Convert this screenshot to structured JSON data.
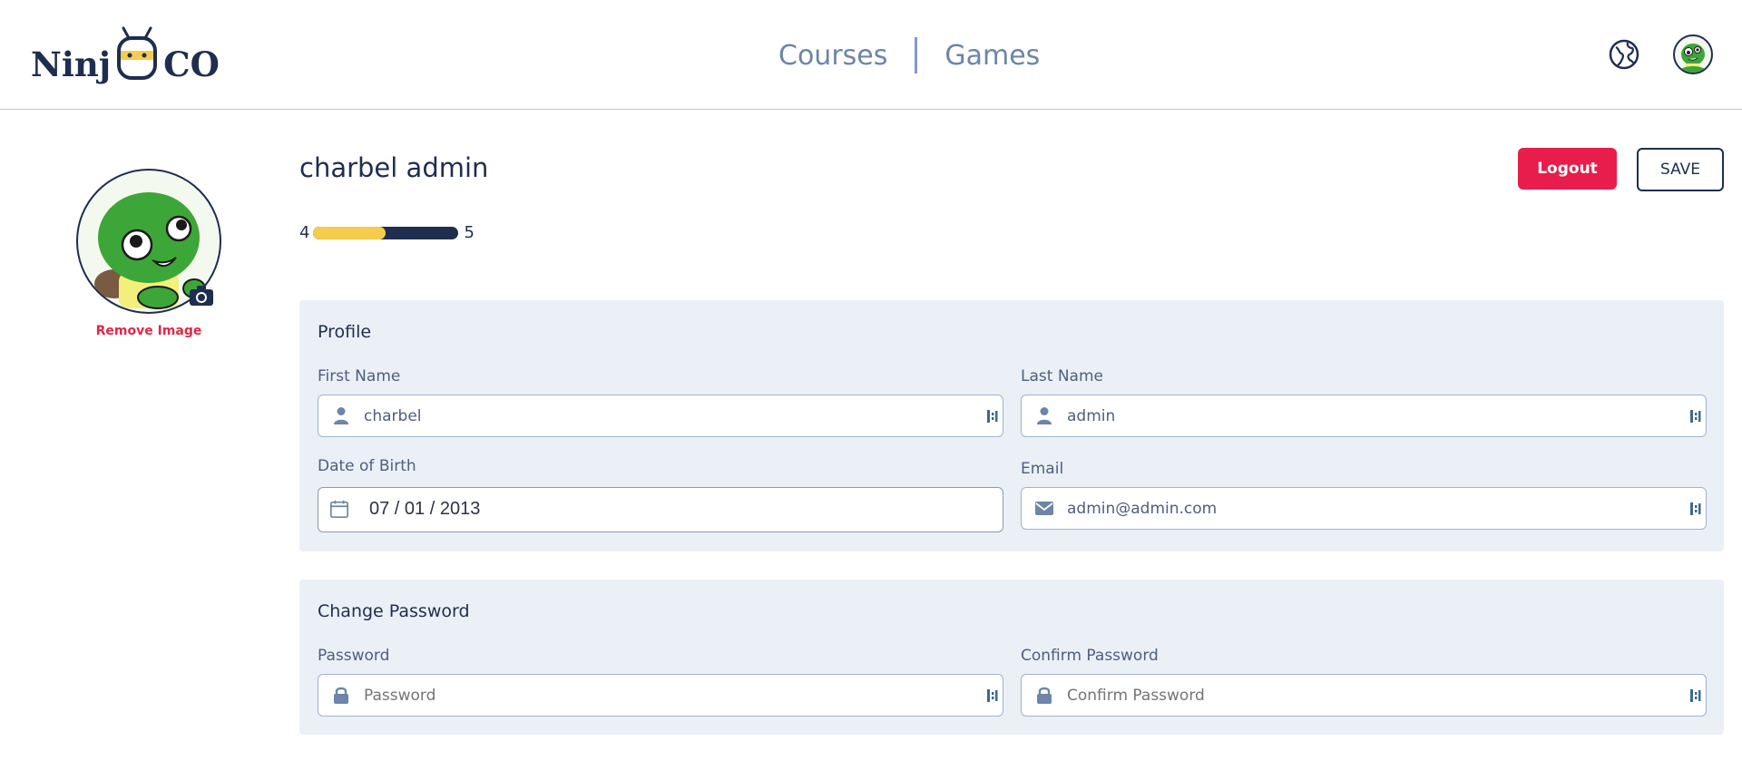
{
  "header": {
    "logo": {
      "text_left": "Ninj",
      "text_right": "CO"
    },
    "nav": [
      {
        "label": "Courses"
      },
      {
        "label": "Games"
      }
    ],
    "icons": {
      "language": "globe-icon",
      "profile": "user-avatar"
    }
  },
  "profile": {
    "name": "charbel admin",
    "remove_image_label": "Remove Image",
    "level": {
      "current": "4",
      "next": "5",
      "progress": 0.5
    },
    "logout_label": "Logout",
    "save_label": "SAVE"
  },
  "profile_section": {
    "title": "Profile",
    "first_name": {
      "label": "First Name",
      "value": "charbel",
      "icon": "user-icon"
    },
    "last_name": {
      "label": "Last Name",
      "value": "admin",
      "icon": "user-icon"
    },
    "dob": {
      "label": "Date of Birth",
      "value": "07 / 01 / 2013",
      "icon": "calendar-icon"
    },
    "email": {
      "label": "Email",
      "value": "admin@admin.com",
      "icon": "mail-icon"
    }
  },
  "password_section": {
    "title": "Change Password",
    "password": {
      "label": "Password",
      "placeholder": "Password",
      "icon": "lock-icon"
    },
    "confirm": {
      "label": "Confirm Password",
      "placeholder": "Confirm Password",
      "icon": "lock-icon"
    }
  },
  "colors": {
    "primary": "#1f2d4f",
    "accent_red": "#e81d4b",
    "card_bg": "#ebf0f6",
    "progress_yellow": "#f5cc4d"
  }
}
